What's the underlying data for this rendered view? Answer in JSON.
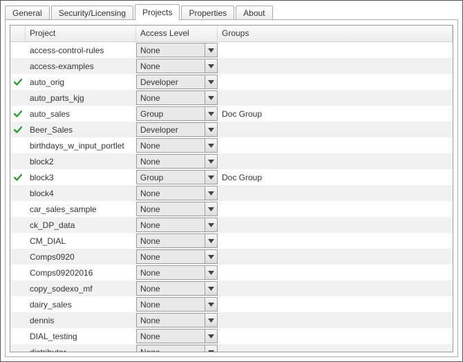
{
  "tabs": [
    {
      "label": "General",
      "active": false
    },
    {
      "label": "Security/Licensing",
      "active": false
    },
    {
      "label": "Projects",
      "active": true
    },
    {
      "label": "Properties",
      "active": false
    },
    {
      "label": "About",
      "active": false
    }
  ],
  "columns": {
    "icon": "",
    "project": "Project",
    "access": "Access Level",
    "groups": "Groups"
  },
  "access_options": [
    "None",
    "Developer",
    "Group"
  ],
  "rows": [
    {
      "checked": false,
      "project": "access-control-rules",
      "access": "None",
      "groups": ""
    },
    {
      "checked": false,
      "project": "access-examples",
      "access": "None",
      "groups": ""
    },
    {
      "checked": true,
      "project": "auto_orig",
      "access": "Developer",
      "groups": ""
    },
    {
      "checked": false,
      "project": "auto_parts_kjg",
      "access": "None",
      "groups": ""
    },
    {
      "checked": true,
      "project": "auto_sales",
      "access": "Group",
      "groups": "Doc Group"
    },
    {
      "checked": true,
      "project": "Beer_Sales",
      "access": "Developer",
      "groups": ""
    },
    {
      "checked": false,
      "project": "birthdays_w_input_portlet",
      "access": "None",
      "groups": ""
    },
    {
      "checked": false,
      "project": "block2",
      "access": "None",
      "groups": ""
    },
    {
      "checked": true,
      "project": "block3",
      "access": "Group",
      "groups": "Doc Group"
    },
    {
      "checked": false,
      "project": "block4",
      "access": "None",
      "groups": ""
    },
    {
      "checked": false,
      "project": "car_sales_sample",
      "access": "None",
      "groups": ""
    },
    {
      "checked": false,
      "project": "ck_DP_data",
      "access": "None",
      "groups": ""
    },
    {
      "checked": false,
      "project": "CM_DIAL",
      "access": "None",
      "groups": ""
    },
    {
      "checked": false,
      "project": "Comps0920",
      "access": "None",
      "groups": ""
    },
    {
      "checked": false,
      "project": "Comps09202016",
      "access": "None",
      "groups": ""
    },
    {
      "checked": false,
      "project": "copy_sodexo_mf",
      "access": "None",
      "groups": ""
    },
    {
      "checked": false,
      "project": "dairy_sales",
      "access": "None",
      "groups": ""
    },
    {
      "checked": false,
      "project": "dennis",
      "access": "None",
      "groups": ""
    },
    {
      "checked": false,
      "project": "DIAL_testing",
      "access": "None",
      "groups": ""
    },
    {
      "checked": false,
      "project": "distributor",
      "access": "None",
      "groups": ""
    }
  ]
}
